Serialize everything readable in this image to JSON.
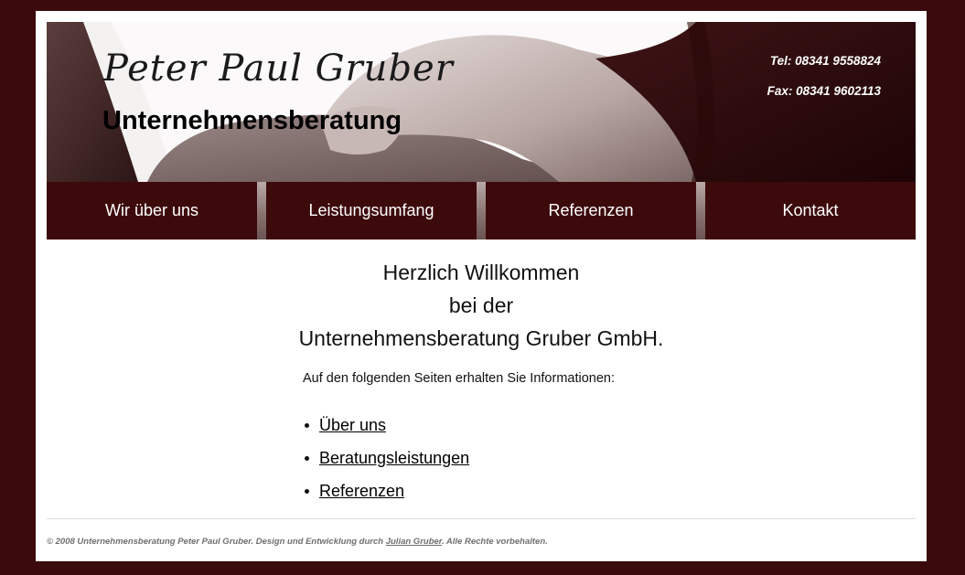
{
  "header": {
    "brand_script": "Peter Paul Gruber",
    "brand_sub": "Unternehmensberatung",
    "tel": "Tel: 08341 9558824",
    "fax": "Fax: 08341 9602113",
    "image_icon": "handshake-icon"
  },
  "nav": {
    "items": [
      {
        "label": "Wir über uns"
      },
      {
        "label": "Leistungsumfang"
      },
      {
        "label": "Referenzen"
      },
      {
        "label": "Kontakt"
      }
    ]
  },
  "main": {
    "welcome_line1": "Herzlich Willkommen",
    "welcome_line2": "bei der",
    "welcome_line3": "Unternehmensberatung Gruber GmbH.",
    "intro": "Auf den folgenden Seiten erhalten Sie Informationen:",
    "links": [
      {
        "label": "Über uns"
      },
      {
        "label": "Beratungsleistungen"
      },
      {
        "label": "Referenzen"
      }
    ]
  },
  "footer": {
    "text_before": "© 2008 Unternehmensberatung Peter Paul Gruber. Design und Entwicklung durch ",
    "author_link": "Julian Gruber",
    "text_after": ". Alle Rechte vorbehalten."
  },
  "colors": {
    "frame": "#3a0a0c",
    "nav_bg": "#3d0a0c",
    "nav_text": "#ffffff"
  }
}
